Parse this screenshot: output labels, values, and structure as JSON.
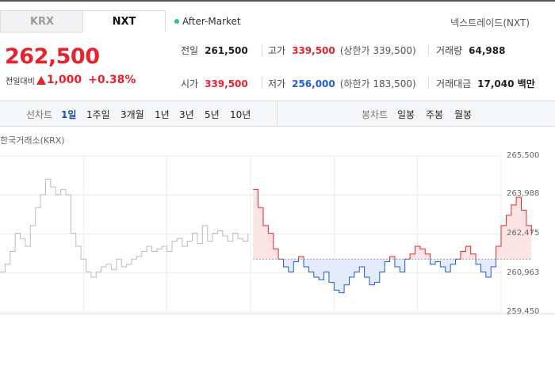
{
  "tabs": {
    "krx": "KRX",
    "nxt": "NXT"
  },
  "market_status": "After-Market",
  "exchange_name": "넥스트레이드(NXT)",
  "price": "262,500",
  "change": {
    "label": "전일대비",
    "amount": "1,000",
    "percent": "+0.38%",
    "direction": "up"
  },
  "stats": {
    "prev_close": {
      "label": "전일",
      "value": "261,500"
    },
    "high": {
      "label": "고가",
      "value": "339,500",
      "limit_label": "(상한가 339,500)"
    },
    "volume": {
      "label": "거래량",
      "value": "64,988"
    },
    "open": {
      "label": "시가",
      "value": "339,500"
    },
    "low": {
      "label": "저가",
      "value": "256,000",
      "limit_label": "(하한가 183,500)"
    },
    "trade_value": {
      "label": "거래대금",
      "value": "17,040 백만"
    }
  },
  "periods": {
    "label": "선차트",
    "items": [
      "1일",
      "1주일",
      "3개월",
      "1년",
      "3년",
      "5년",
      "10년"
    ],
    "active": "1일"
  },
  "candles": {
    "label": "봉차트",
    "items": [
      "일봉",
      "주봉",
      "월봉"
    ]
  },
  "chart_source": "한국거래소(KRX)",
  "colors": {
    "up": "#e8232e",
    "down": "#1e5ed6",
    "krx_line": "#bbbbbb",
    "up_fill": "#fde4e4",
    "down_fill": "#e4ecfb",
    "dot": "#27c38d"
  },
  "chart_data": {
    "type": "line",
    "ylabels": [
      "265,500",
      "263,988",
      "262,475",
      "260,963",
      "259,450"
    ],
    "ylim": [
      259450,
      265500
    ],
    "baseline": 261500,
    "x_count": 100,
    "series": [
      {
        "name": "KRX",
        "x_start": 0,
        "values": [
          261000,
          261300,
          261800,
          262500,
          262300,
          262000,
          262800,
          263500,
          264000,
          264600,
          264300,
          264000,
          264200,
          264000,
          262500,
          262000,
          261500,
          261000,
          260800,
          261000,
          261200,
          261300,
          261100,
          261500,
          261200,
          261300,
          261500,
          261600,
          261800,
          262000,
          261800,
          261900,
          262000,
          261800,
          262200,
          262300,
          262000,
          262200,
          262500,
          262100,
          262800,
          262200,
          262500,
          262600,
          262400,
          262200,
          262500,
          262300,
          262200,
          262500
        ]
      },
      {
        "name": "NXT",
        "x_start": 50,
        "values": [
          264200,
          263500,
          262800,
          262500,
          261900,
          261500,
          261200,
          261000,
          261400,
          261600,
          261200,
          261000,
          260800,
          260700,
          261000,
          260600,
          260300,
          260200,
          260500,
          260800,
          261000,
          261200,
          260800,
          260500,
          260600,
          261000,
          261400,
          261600,
          261200,
          261000,
          261500,
          261700,
          262000,
          261900,
          261700,
          261300,
          261400,
          261200,
          261000,
          261300,
          261500,
          261800,
          262000,
          261700,
          261300,
          261000,
          260800,
          261200,
          262000,
          262800,
          263200,
          263600,
          263900,
          263400,
          262800,
          262500
        ]
      }
    ]
  }
}
